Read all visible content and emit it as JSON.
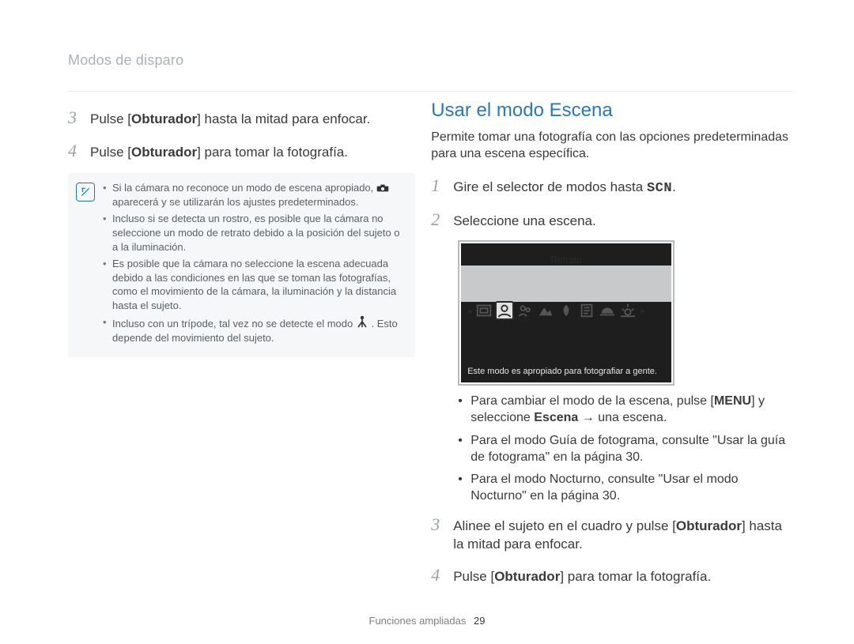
{
  "header": {
    "section": "Modos de disparo"
  },
  "left": {
    "steps": [
      {
        "num": "3",
        "pre": "Pulse [",
        "bold": "Obturador",
        "post": "] hasta la mitad para enfocar."
      },
      {
        "num": "4",
        "pre": "Pulse [",
        "bold": "Obturador",
        "post": "] para tomar la fotografía."
      }
    ],
    "callout": [
      "Si la cámara no reconoce un modo de escena apropiado, ⬚ aparecerá y se utilizarán los ajustes predeterminados.",
      "Incluso si se detecta un rostro, es posible que la cámara no seleccione un modo de retrato debido a la posición del sujeto o a la iluminación.",
      "Es posible que la cámara no seleccione la escena adecuada debido a las condiciones en las que se toman las fotografías, como el movimiento de la cámara, la iluminación y la distancia hasta el sujeto.",
      "Incluso con un trípode, tal vez no se detecte el modo ⬚. Esto depende del movimiento del sujeto."
    ]
  },
  "right": {
    "title": "Usar el modo Escena",
    "intro": "Permite tomar una fotografía con las opciones predeterminadas para una escena específica.",
    "steps12": [
      {
        "num": "1",
        "text_pre": "Gire el selector de modos hasta ",
        "scn": "SCN",
        "text_post": "."
      },
      {
        "num": "2",
        "text_pre": "Seleccione una escena.",
        "scn": "",
        "text_post": ""
      }
    ],
    "lcd": {
      "label": "Retrato",
      "caption": "Este modo es apropiado para fotografiar a gente.",
      "icons": [
        "frame-guide-icon",
        "portrait-icon",
        "children-icon",
        "landscape-icon",
        "closeup-icon",
        "text-icon",
        "sunset-icon",
        "dawn-icon"
      ]
    },
    "bullets": [
      {
        "parts": [
          {
            "t": "text",
            "v": "Para cambiar el modo de la escena, pulse ["
          },
          {
            "t": "bold",
            "v": "MENU"
          },
          {
            "t": "text",
            "v": "] y seleccione "
          },
          {
            "t": "bold",
            "v": "Escena"
          },
          {
            "t": "text",
            "v": " → una escena."
          }
        ]
      },
      {
        "parts": [
          {
            "t": "text",
            "v": "Para el modo Guía de fotograma, consulte \"Usar la guía de fotograma\" en la página 30."
          }
        ]
      },
      {
        "parts": [
          {
            "t": "text",
            "v": "Para el modo Nocturno, consulte \"Usar el modo Nocturno\" en la página 30."
          }
        ]
      }
    ],
    "steps34": [
      {
        "num": "3",
        "parts": [
          {
            "t": "text",
            "v": "Alinee el sujeto en el cuadro y pulse ["
          },
          {
            "t": "bold",
            "v": "Obturador"
          },
          {
            "t": "text",
            "v": "] hasta la mitad para enfocar."
          }
        ]
      },
      {
        "num": "4",
        "parts": [
          {
            "t": "text",
            "v": "Pulse ["
          },
          {
            "t": "bold",
            "v": "Obturador"
          },
          {
            "t": "text",
            "v": "] para tomar la fotografía."
          }
        ]
      }
    ]
  },
  "footer": {
    "label": "Funciones ampliadas",
    "page": "29"
  }
}
